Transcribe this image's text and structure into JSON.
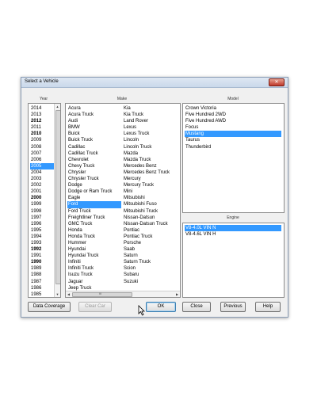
{
  "dialog": {
    "title": "Select a Vehicle",
    "close_label": "✕"
  },
  "headers": {
    "year": "Year",
    "make": "Make",
    "model": "Model",
    "engine": "Engine"
  },
  "years": [
    {
      "label": "2014",
      "bold": false
    },
    {
      "label": "2013",
      "bold": false
    },
    {
      "label": "2012",
      "bold": true
    },
    {
      "label": "2011",
      "bold": false
    },
    {
      "label": "2010",
      "bold": true
    },
    {
      "label": "2009",
      "bold": false
    },
    {
      "label": "2008",
      "bold": false
    },
    {
      "label": "2007",
      "bold": false
    },
    {
      "label": "2006",
      "bold": false
    },
    {
      "label": "2005",
      "bold": false,
      "selected": true
    },
    {
      "label": "2004",
      "bold": false
    },
    {
      "label": "2003",
      "bold": false
    },
    {
      "label": "2002",
      "bold": false
    },
    {
      "label": "2001",
      "bold": false
    },
    {
      "label": "2000",
      "bold": true
    },
    {
      "label": "1999",
      "bold": false
    },
    {
      "label": "1998",
      "bold": false
    },
    {
      "label": "1997",
      "bold": false
    },
    {
      "label": "1996",
      "bold": false
    },
    {
      "label": "1995",
      "bold": false
    },
    {
      "label": "1994",
      "bold": false
    },
    {
      "label": "1993",
      "bold": false
    },
    {
      "label": "1992",
      "bold": true
    },
    {
      "label": "1991",
      "bold": false
    },
    {
      "label": "1990",
      "bold": true
    },
    {
      "label": "1989",
      "bold": false
    },
    {
      "label": "1988",
      "bold": false
    },
    {
      "label": "1987",
      "bold": false
    },
    {
      "label": "1986",
      "bold": false
    },
    {
      "label": "1985",
      "bold": false
    }
  ],
  "makes_col1": [
    "Acura",
    "Acura Truck",
    "Audi",
    "BMW",
    "Buick",
    "Buick Truck",
    "Cadillac",
    "Cadillac Truck",
    "Chevrolet",
    "Chevy Truck",
    "Chrysler",
    "Chrysler Truck",
    "Dodge",
    "Dodge or Ram Truck",
    "Eagle",
    "Ford",
    "Ford Truck",
    "Freightliner Truck",
    "GMC Truck",
    "Honda",
    "Honda Truck",
    "Hummer",
    "Hyundai",
    "Hyundai Truck",
    "Infiniti",
    "Infiniti Truck",
    "Isuzu Truck",
    "Jaguar",
    "Jeep Truck"
  ],
  "makes_col2": [
    "Kia",
    "Kia Truck",
    "Land Rover",
    "Lexus",
    "Lexus Truck",
    "Lincoln",
    "Lincoln Truck",
    "Mazda",
    "Mazda Truck",
    "Mercedes Benz",
    "Mercedes Benz Truck",
    "Mercury",
    "Mercury Truck",
    "Mini",
    "Mitsubishi",
    "Mitsubishi Fuso",
    "Mitsubishi Truck",
    "Nissan-Datsun",
    "Nissan-Datsun Truck",
    "Pontiac",
    "Pontiac Truck",
    "Porsche",
    "Saab",
    "Saturn",
    "Saturn Truck",
    "Scion",
    "Subaru",
    "Suzuki"
  ],
  "selected_make": "Ford",
  "models": [
    "Crown Victoria",
    "Five Hundred 2WD",
    "Five Hundred AWD",
    "Focus",
    "Mustang",
    "Taurus",
    "Thunderbird"
  ],
  "selected_model": "Mustang",
  "engines": [
    "V8-4.0L VIN N",
    "V8-4.6L VIN H"
  ],
  "selected_engine": "V8-4.0L VIN N",
  "scroll_grip": "III",
  "buttons": {
    "data_coverage": "Data Coverage",
    "clear_car": "Clear Car",
    "ok": "OK",
    "close": "Close",
    "previous": "Previous",
    "help": "Help"
  },
  "colors": {
    "selection": "#3399ff",
    "dialog_bg": "#f0f0f0"
  }
}
